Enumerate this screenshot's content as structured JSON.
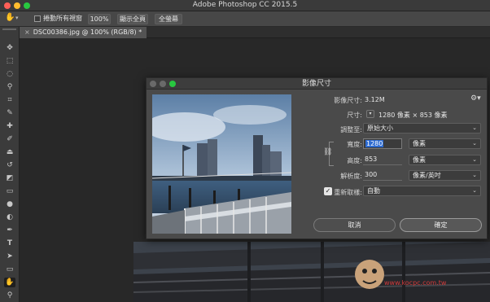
{
  "app": {
    "title": "Adobe Photoshop CC 2015.5",
    "colors": {
      "close": "#ff5f57",
      "minimize": "#febc2e",
      "zoom": "#28c840",
      "accent": "#2e6bd0"
    }
  },
  "options_bar": {
    "scroll_all_label": "捲動所有視窗",
    "zoom_100_label": "100%",
    "fit_screen_label": "顯示全頁",
    "fill_screen_label": "全螢幕"
  },
  "document_tab": {
    "label": "DSC00386.jpg @ 100% (RGB/8) *"
  },
  "tools": [
    "move-icon",
    "marquee-icon",
    "lasso-icon",
    "quick-select-icon",
    "crop-icon",
    "eyedropper-icon",
    "healing-icon",
    "brush-icon",
    "stamp-icon",
    "history-brush-icon",
    "eraser-icon",
    "gradient-icon",
    "blur-icon",
    "dodge-icon",
    "pen-icon",
    "type-icon",
    "path-select-icon",
    "rectangle-icon",
    "hand-icon",
    "zoom-icon"
  ],
  "dialog": {
    "title": "影像尺寸",
    "image_size_label": "影像尺寸:",
    "image_size_value": "3.12M",
    "dimensions_label": "尺寸:",
    "dimensions_value": "1280 像素 × 853 像素",
    "fit_to_label": "調整至:",
    "fit_to_value": "原始大小",
    "width_label": "寬度:",
    "width_value": "1280",
    "width_unit": "像素",
    "height_label": "高度:",
    "height_value": "853",
    "height_unit": "像素",
    "resolution_label": "解析度:",
    "resolution_value": "300",
    "resolution_unit": "像素/英吋",
    "resample_label": "重新取樣:",
    "resample_checked": true,
    "resample_value": "自動",
    "cancel_label": "取消",
    "ok_label": "確定"
  },
  "watermark": {
    "text": "www.kocpc.com.tw"
  }
}
